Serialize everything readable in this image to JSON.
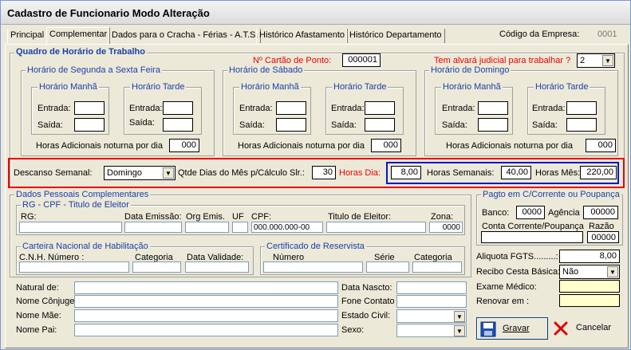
{
  "window": {
    "title": "Cadastro de Funcionario Modo Alteração"
  },
  "tabs": [
    "Principal",
    "Complementar",
    "Dados para o Cracha - Férias - A.T.S.",
    "Histórico Afastamento",
    "Histórico Departamento"
  ],
  "company": {
    "label": "Código da Empresa:",
    "value": "0001"
  },
  "schedule": {
    "title": "Quadro de Horário de Trabalho",
    "card_label": "Nº Cartão de Ponto:",
    "card_value": "000001",
    "judicial_label": "Tem alvará judicial para trabalhar ?",
    "judicial_value": "2",
    "weekday": {
      "title": "Horário de Segunda a Sexta Feira"
    },
    "saturday": {
      "title": "Horário de Sábado"
    },
    "sunday": {
      "title": "Horário de Domingo"
    },
    "morning": "Horário Manhã",
    "afternoon": "Horário Tarde",
    "entrada": "Entrada:",
    "saida": "Saída:",
    "extra_label": "Horas Adicionais noturna por dia",
    "extra_weekday": "000",
    "extra_saturday": "000",
    "extra_sunday": "000"
  },
  "rest": {
    "label": "Descanso Semanal:",
    "value": "Domingo",
    "days_label": "Qtde Dias do Mês p/Cálculo Slr.:",
    "days_value": "30",
    "hours_day_label": "Horas Dia:",
    "hours_day": "8,00",
    "hours_week_label": "Horas Semanais:",
    "hours_week": "40,00",
    "hours_month_label": "Horas Mês:",
    "hours_month": "220,00"
  },
  "personal": {
    "title": "Dados Pessoais Complementares",
    "docs_title": "RG - CPF - Titulo de Eleitor",
    "rg": "RG:",
    "data_emissao": "Data Emissão:",
    "orgao": "Org Emis.",
    "uf": "UF",
    "cpf": "CPF:",
    "cpf_value": "000.000.000-00",
    "titulo": "Titulo de  Eleitor:",
    "zona": "Zona:",
    "zona_value": "0000",
    "cnh_title": "Carteira Nacional de Habilitação",
    "cnh_numero": "C.N.H. Número :",
    "categoria": "Categoria",
    "validade": "Data  Validade:",
    "reservista_title": "Certificado de Reservista",
    "numero": "Número",
    "serie": "Série",
    "categoria2": "Categoria",
    "natural": "Natural de:",
    "conjuge": "Nome Cônjuge:",
    "mae": "Nome Mãe:",
    "pai": "Nome Pai:",
    "nascto": "Data Nascto:",
    "fone": "Fone Contato",
    "civil": "Estado Civil:",
    "sexo": "Sexo:"
  },
  "bank": {
    "title": "Pagto em C/Corrente ou Poupança",
    "banco": "Banco:",
    "banco_value": "0000",
    "agencia": "Agência",
    "agencia_value": "00000",
    "conta": "Conta Corrente/Poupança",
    "razao": "Razão",
    "razao_value": "00000"
  },
  "fgts": {
    "label": "Aliquota FGTS.........:",
    "value": "8,00"
  },
  "cesta": {
    "label": "Recibo Cesta Básica:",
    "value": "Não"
  },
  "exame": {
    "label": "Exame Médico:"
  },
  "renovar": {
    "label": "Renovar em :"
  },
  "buttons": {
    "save": "Gravar",
    "cancel": "Cancelar"
  }
}
